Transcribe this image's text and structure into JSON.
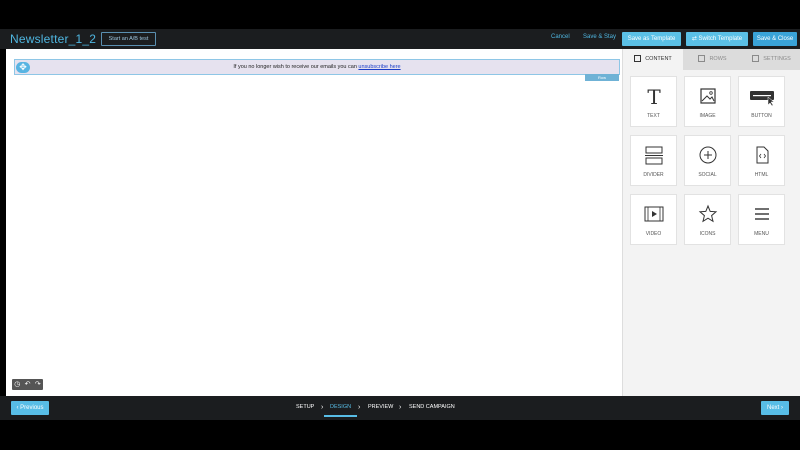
{
  "header": {
    "title": "Newsletter_1_2",
    "ab_test_label": "Start an A/B test",
    "cancel_label": "Cancel",
    "save_stay_label": "Save & Stay",
    "save_template_label": "Save as Template",
    "switch_template_label": "⇄ Switch Template",
    "save_close_label": "Save & Close"
  },
  "canvas": {
    "unsubscribe_prefix": "If you no longer wish to receive our emails you can ",
    "unsubscribe_link": "unsubscribe here",
    "row_tag": "Row"
  },
  "panel": {
    "tabs": [
      {
        "label": "CONTENT"
      },
      {
        "label": "ROWS"
      },
      {
        "label": "SETTINGS"
      }
    ],
    "tiles": [
      {
        "label": "TEXT",
        "icon": "text-icon"
      },
      {
        "label": "IMAGE",
        "icon": "image-icon"
      },
      {
        "label": "BUTTON",
        "icon": "button-icon"
      },
      {
        "label": "DIVIDER",
        "icon": "divider-icon"
      },
      {
        "label": "SOCIAL",
        "icon": "social-icon"
      },
      {
        "label": "HTML",
        "icon": "html-icon"
      },
      {
        "label": "VIDEO",
        "icon": "video-icon"
      },
      {
        "label": "ICONS",
        "icon": "star-icon"
      },
      {
        "label": "MENU",
        "icon": "menu-icon"
      }
    ]
  },
  "footer": {
    "previous_label": "‹ Previous",
    "next_label": "Next ›",
    "steps": [
      {
        "label": "SETUP"
      },
      {
        "label": "DESIGN"
      },
      {
        "label": "PREVIEW"
      },
      {
        "label": "SEND CAMPAIGN"
      }
    ]
  },
  "colors": {
    "accent": "#58bde6",
    "bar": "#1b1d1f",
    "link": "#1a3ec8"
  }
}
